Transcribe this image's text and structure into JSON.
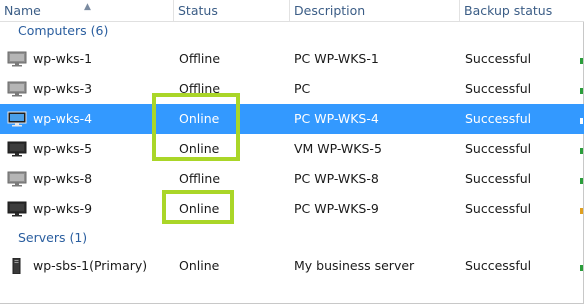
{
  "columns": [
    {
      "label": "Name"
    },
    {
      "label": "Status"
    },
    {
      "label": "Description"
    },
    {
      "label": "Backup status"
    }
  ],
  "groups": [
    {
      "label": "Computers (6)"
    },
    {
      "label": "Servers (1)"
    }
  ],
  "rows": [
    {
      "name": "wp-wks-1",
      "status": "Offline",
      "description": "PC WP-WKS-1",
      "backup": "Successful",
      "icon": "monitor-icon-offline"
    },
    {
      "name": "wp-wks-3",
      "status": "Offline",
      "description": "PC",
      "backup": "Successful",
      "icon": "monitor-icon-offline"
    },
    {
      "name": "wp-wks-4",
      "status": "Online",
      "description": "PC WP-WKS-4",
      "backup": "Successful",
      "icon": "monitor-icon-online",
      "selected": true
    },
    {
      "name": "wp-wks-5",
      "status": "Online",
      "description": "VM WP-WKS-5",
      "backup": "Successful",
      "icon": "monitor-icon-online"
    },
    {
      "name": "wp-wks-8",
      "status": "Offline",
      "description": "PC WP-WKS-8",
      "backup": "Successful",
      "icon": "monitor-icon-offline"
    },
    {
      "name": "wp-wks-9",
      "status": "Online",
      "description": "PC WP-WKS-9",
      "backup": "Successful",
      "icon": "monitor-icon-online"
    },
    {
      "name": "wp-sbs-1(Primary)",
      "status": "Online",
      "description": "My business server",
      "backup": "Successful",
      "icon": "server-tower-icon"
    }
  ],
  "colors": {
    "selection": "#3399ff",
    "highlight_box": "#aad628",
    "header_text": "#3b5d86",
    "group_text": "#2a5e9f"
  }
}
